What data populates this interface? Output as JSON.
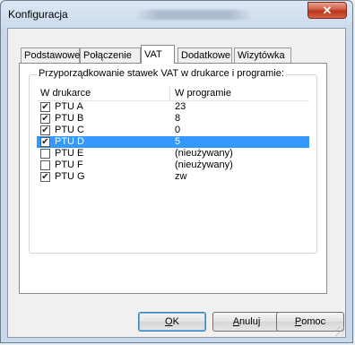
{
  "window": {
    "title": "Konfiguracja",
    "close_label": "✕"
  },
  "tabs": [
    {
      "label": "Podstawowe",
      "active": false
    },
    {
      "label": "Połączenie",
      "active": false
    },
    {
      "label": "VAT",
      "active": true
    },
    {
      "label": "Dodatkowe",
      "active": false
    },
    {
      "label": "Wizytówka",
      "active": false
    }
  ],
  "group": {
    "label": "Przyporządkowanie stawek VAT w drukarce i programie:",
    "columns": [
      "W drukarce",
      "W programie"
    ],
    "rows": [
      {
        "printer": "PTU A",
        "program": "23",
        "checked": true,
        "selected": false
      },
      {
        "printer": "PTU B",
        "program": "8",
        "checked": true,
        "selected": false
      },
      {
        "printer": "PTU C",
        "program": "0",
        "checked": true,
        "selected": false
      },
      {
        "printer": "PTU D",
        "program": "5",
        "checked": true,
        "selected": true
      },
      {
        "printer": "PTU E",
        "program": "(nieużywany)",
        "checked": false,
        "selected": false
      },
      {
        "printer": "PTU F",
        "program": "(nieużywany)",
        "checked": false,
        "selected": false
      },
      {
        "printer": "PTU G",
        "program": "zw",
        "checked": true,
        "selected": false
      }
    ]
  },
  "buttons": {
    "ok": {
      "accel": "O",
      "rest": "K"
    },
    "cancel": {
      "accel": "A",
      "rest": "nuluj"
    },
    "help": {
      "accel": "P",
      "rest": "omoc"
    }
  },
  "colors": {
    "selection": "#3399ff",
    "close": "#c8432b"
  }
}
